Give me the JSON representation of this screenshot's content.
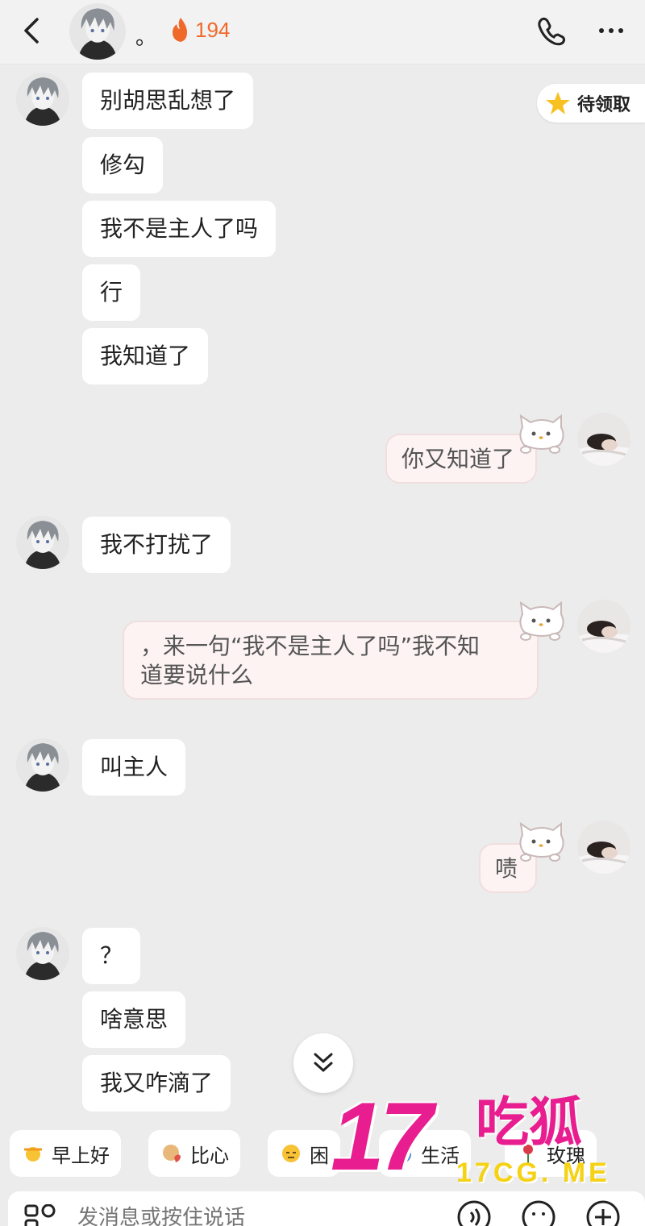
{
  "header": {
    "contact_name": "。",
    "streak_count": "194"
  },
  "reward_badge": {
    "label": "待领取"
  },
  "messages": [
    {
      "side": "other",
      "text": "别胡思乱想了"
    },
    {
      "side": "other",
      "text": "修勾"
    },
    {
      "side": "other",
      "text": "我不是主人了吗"
    },
    {
      "side": "other",
      "text": "行"
    },
    {
      "side": "other",
      "text": "我知道了"
    },
    {
      "side": "self",
      "text": "你又知道了"
    },
    {
      "side": "other",
      "text": "我不打扰了"
    },
    {
      "side": "self",
      "text_line1": "，来一句“我不是主人了吗”我不知",
      "text_line2": "道要说什么"
    },
    {
      "side": "other",
      "text": "叫主人"
    },
    {
      "side": "self",
      "text": "啧"
    },
    {
      "side": "other",
      "text": "？"
    },
    {
      "side": "other",
      "text": "啥意思"
    },
    {
      "side": "other",
      "text": "我又咋滴了"
    }
  ],
  "quick_replies": [
    {
      "label": "早上好",
      "icon": "sun-emoji"
    },
    {
      "label": "比心",
      "icon": "heart-hands-emoji"
    },
    {
      "label": "困",
      "icon": "sleepy-emoji"
    },
    {
      "label": "生活",
      "icon": "alarm-clock-emoji"
    },
    {
      "label": "玫瑰",
      "icon": "rose-emoji"
    }
  ],
  "input": {
    "placeholder": "发消息或按住说话"
  },
  "watermark": {
    "main": "17",
    "cn": "吃狐",
    "url": "17CG. ME"
  },
  "colors": {
    "accent_orange": "#ef6a2a",
    "self_bubble_bg": "#fdf3f3",
    "watermark_pink": "#e81d8f",
    "watermark_yellow": "#f5d214"
  }
}
